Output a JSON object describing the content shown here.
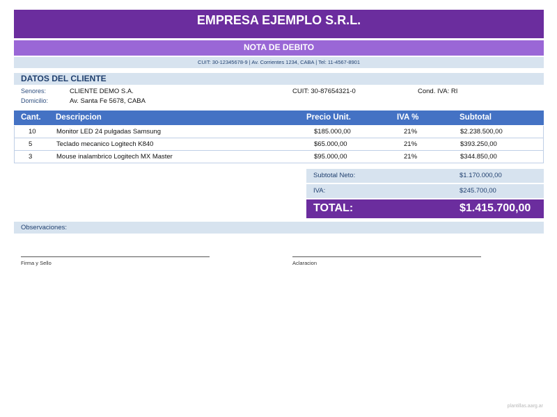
{
  "header": {
    "company": "EMPRESA EJEMPLO S.R.L.",
    "doc_type": "NOTA DE DEBITO",
    "info_line": "CUIT: 30-12345678-9  |  Av. Corrientes 1234, CABA  |  Tel: 11-4567-8901"
  },
  "client": {
    "section_title": "DATOS DEL CLIENTE",
    "name_label": "Senores:",
    "name": "CLIENTE DEMO S.A.",
    "cuit_label": "CUIT:",
    "cuit": "30-87654321-0",
    "iva_label": "Cond. IVA:",
    "iva": "RI",
    "address_label": "Domicilio:",
    "address": "Av. Santa Fe 5678, CABA"
  },
  "table": {
    "headers": {
      "qty": "Cant.",
      "description": "Descripcion",
      "unit_price": "Precio Unit.",
      "iva": "IVA %",
      "subtotal": "Subtotal"
    },
    "rows": [
      {
        "qty": "10",
        "description": "Monitor LED 24 pulgadas Samsung",
        "unit_price": "$185.000,00",
        "iva": "21%",
        "subtotal": "$2.238.500,00"
      },
      {
        "qty": "5",
        "description": "Teclado mecanico Logitech K840",
        "unit_price": "$65.000,00",
        "iva": "21%",
        "subtotal": "$393.250,00"
      },
      {
        "qty": "3",
        "description": "Mouse inalambrico Logitech MX Master",
        "unit_price": "$95.000,00",
        "iva": "21%",
        "subtotal": "$344.850,00"
      }
    ]
  },
  "totals": {
    "net_label": "Subtotal Neto:",
    "net_value": "$1.170.000,00",
    "iva_label": "IVA:",
    "iva_value": "$245.700,00",
    "total_label": "TOTAL:",
    "total_value": "$1.415.700,00"
  },
  "observations_label": "Observaciones:",
  "signatures": {
    "left": "Firma y Sello",
    "right": "Aclaracion"
  },
  "footer": "plantillas.aarg.ar",
  "colors": {
    "primary_purple": "#6b2d9e",
    "light_purple": "#9a67d6",
    "table_header_blue": "#4472c4",
    "light_blue_band": "#d7e3ef"
  }
}
